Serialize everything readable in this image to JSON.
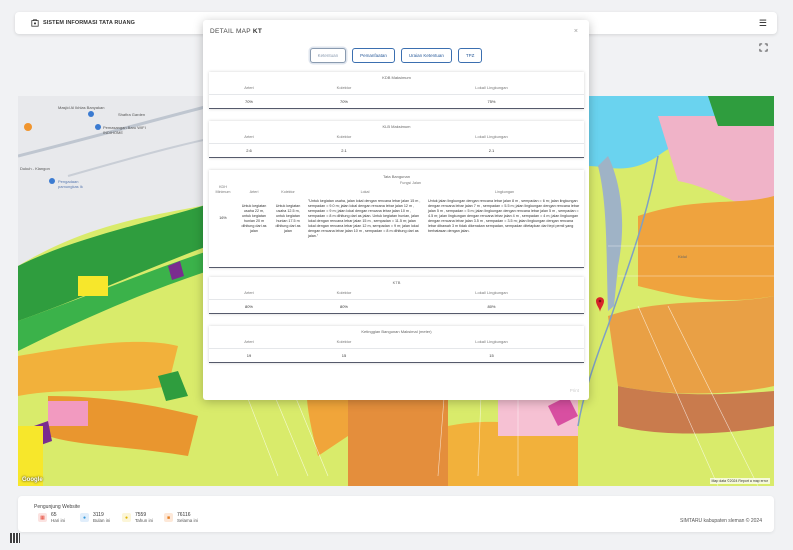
{
  "navbar": {
    "title": "SISTEM INFORMASI TATA RUANG"
  },
  "map": {
    "labels": {
      "masjid": "Masjid Al Ikhlas Banyakan",
      "wifi": "Pemasangan Baru WIFI INDIHOME",
      "garden": "Shafira Garden",
      "road": "Dukuh - Klangon",
      "pc": "Pengadaan pamungkas Ik",
      "kidul": "Kidul"
    },
    "google": "Google",
    "attribution": "Map data ©2024   Report a map error"
  },
  "modal": {
    "title_prefix": "DETAIL MAP ",
    "title_code": "KT",
    "close": "×",
    "tabs": [
      {
        "label": "Ketentuan"
      },
      {
        "label": "Pemanfaatan"
      },
      {
        "label": "Uraian Ketentuan"
      },
      {
        "label": "TPZ"
      }
    ],
    "print": "Print",
    "kdb": {
      "heading": "KDB Maksimum",
      "cols": [
        "Arteri",
        "Kolektor",
        "Lokal/ Lingkungan"
      ],
      "vals": [
        "70%",
        "70%",
        "75%"
      ]
    },
    "klb": {
      "heading": "KLB Maksimum",
      "cols": [
        "Arteri",
        "Kolektor",
        "Lokal/ Lingkungan"
      ],
      "vals": [
        "2.6",
        "2.1",
        "2.1"
      ]
    },
    "tata": {
      "heading": "Tata Bangunan",
      "kdh_label": "KDH Minimum",
      "fungsi": "Fungsi Jalan",
      "cols": [
        "Arteri",
        "Kolektor",
        "Lokal",
        "Lingkungan"
      ],
      "kdh": "16%",
      "arteri": "Untuk kegiatan usaha 22 m, untuk kegiatan hunian 20 m dihitung dari as jalan",
      "kolektor": "Untuk kegiatan usaha 12.5 m, untuk kegiatan hunian 17.5 m dihitung dari as jalan",
      "lokal": "\"Untuk kegiatan usaha, jalan lokal dengan rencana lebar jalan 15 m , sempadan = 9.0 m; jalan lokal dengan rencana lebar jalan 12 m , sempadan = 9 m; jalan lokal dengan rencana lebar jalan 10 m , sempadan = 8 m dihitung dari as jalan. Untuk kegiatan hunian, jalan lokal dengan rencana lebar jalan 15 m , sempadan = 11.5 m; jalan lokal dengan rencana lebar jalan 12 m, sempadan = 9 m; jalan lokal dengan rencana lebar jalan 10 m , sempadan = 8 m dihitung dari as jalan.\"",
      "lingkungan": "Untuk jalan lingkungan dengan rencana lebar jalan 8 m , sempadan = 6 m; jalan lingkungan dengan rencana lebar jalan 7 m , sempadan = 5.5 m; jalan lingkungan dengan rencana lebar jalan 5 m , sempadan = 5 m; jalan lingkungan dengan rencana lebar jalan 5 m , sempadan = 4.5 m; jalan lingkungan dengan rencana lebar jalan 4 m , sempadan = 4 m; jalan lingkungan dengan rencana lebar jalan 3.5 m , sempadan = 3.5 m; jalan lingkungan dengan rencana lebar dibawah 3 m tidak dikenakan sempadan, sempadan ditetapkan dari tepi pemil yang berbatasan dengan jalan."
    },
    "ktb": {
      "heading": "KTB",
      "cols": [
        "Arteri",
        "Kolektor",
        "Lokal/ Lingkungan"
      ],
      "vals": [
        "80%",
        "80%",
        "80%"
      ]
    },
    "ketinggian": {
      "heading": "Ketinggian Bangunan Maksimal (meter)",
      "cols": [
        "Arteri",
        "Kolektor",
        "Lokal/ Lingkungan"
      ],
      "vals": [
        "19",
        "15",
        "15"
      ]
    }
  },
  "footer": {
    "title": "Pengunjung Website",
    "stats": [
      {
        "num": "65",
        "label": "Hari ini",
        "color": "#e74c3c"
      },
      {
        "num": "3119",
        "label": "Bulan ini",
        "color": "#3498db"
      },
      {
        "num": "7559",
        "label": "Tahun ini",
        "color": "#f1c40f"
      },
      {
        "num": "76116",
        "label": "Selama ini",
        "color": "#e67e22"
      }
    ],
    "copyright": "SIMTARU kabupaten sleman © 2024"
  }
}
